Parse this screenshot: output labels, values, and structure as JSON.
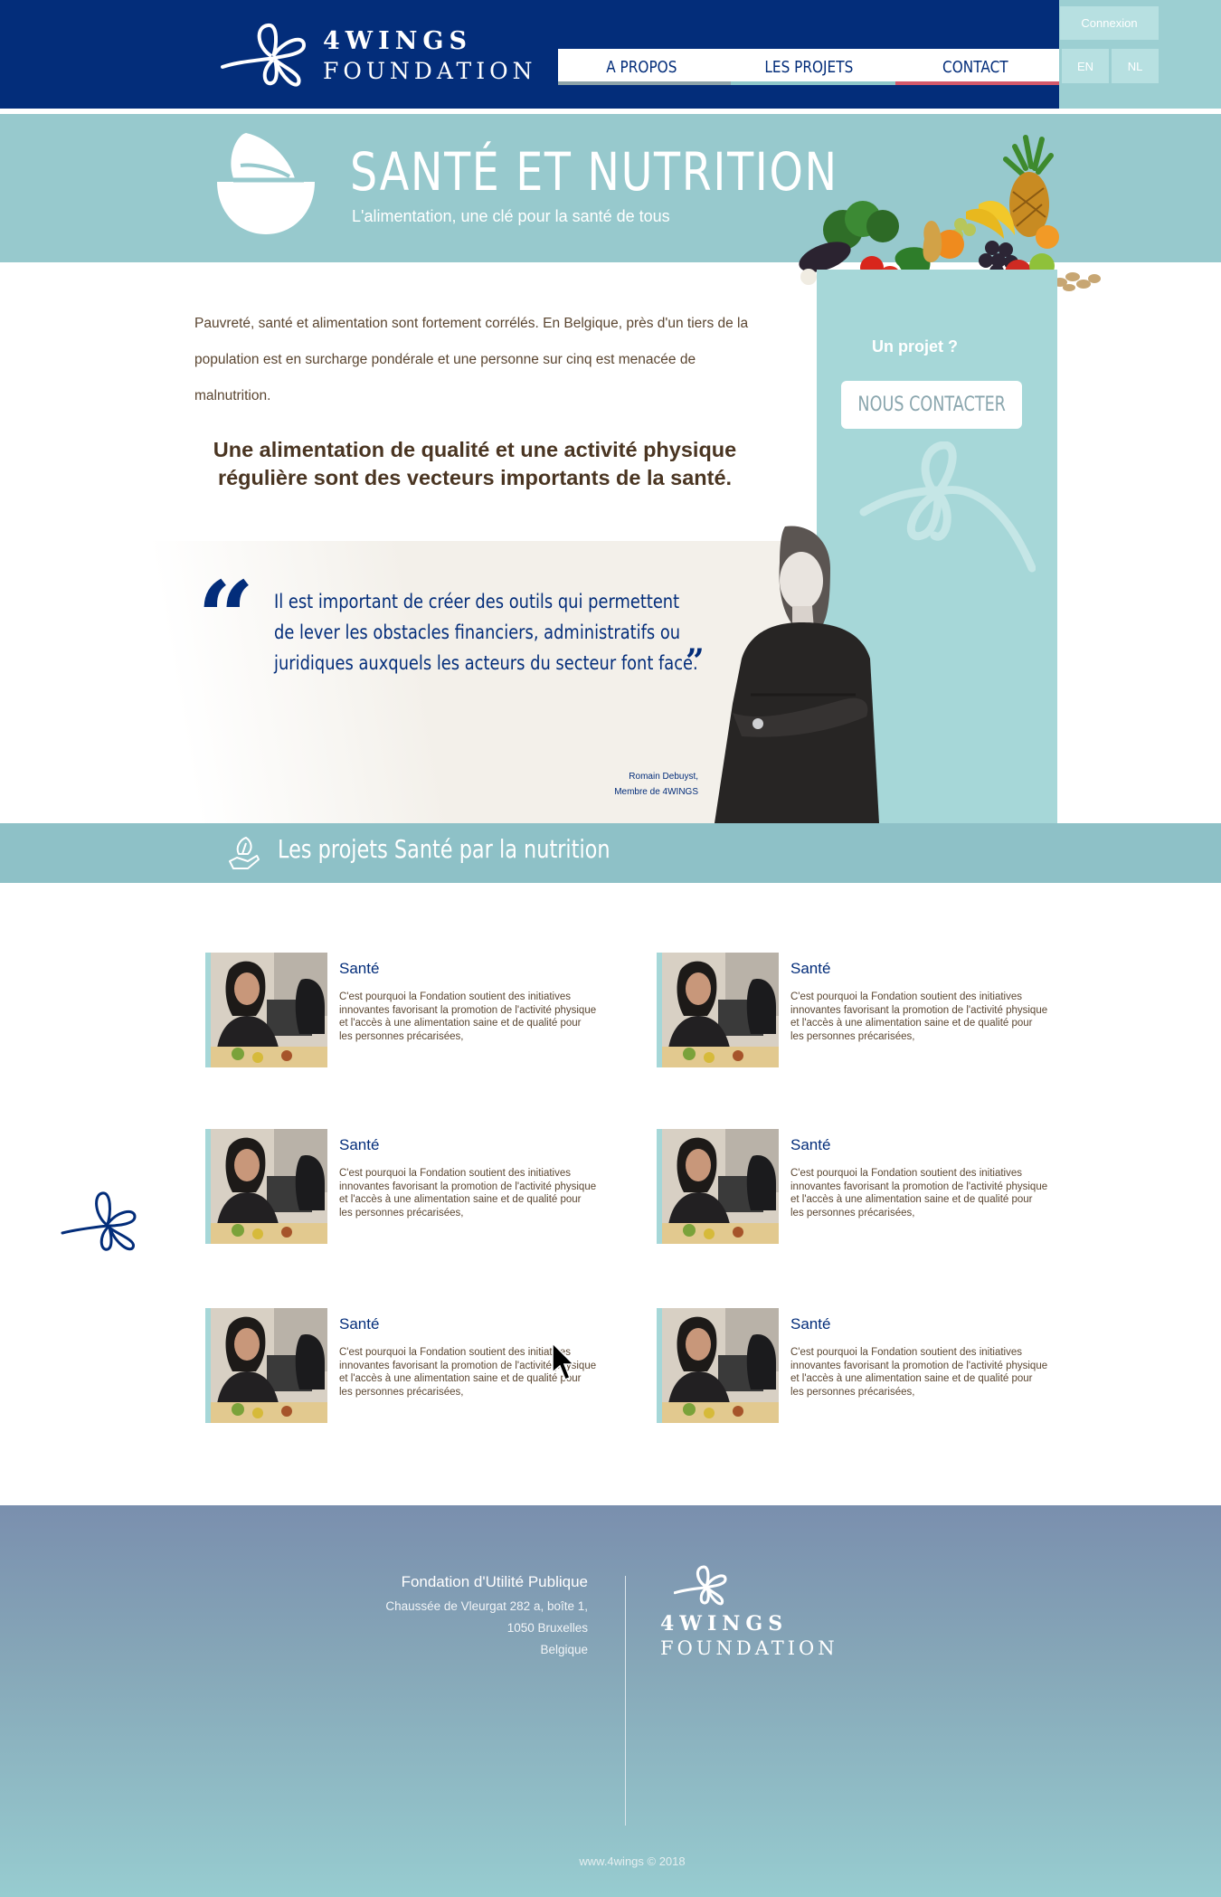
{
  "brand": {
    "name_line1": "4WINGS",
    "name_line2": "FOUNDATION"
  },
  "nav": {
    "items": [
      {
        "label": "A PROPOS"
      },
      {
        "label": "LES PROJETS"
      },
      {
        "label": "CONTACT"
      }
    ],
    "login_label": "Connexion",
    "languages": [
      "EN",
      "NL"
    ]
  },
  "hero": {
    "title": "SANTÉ ET NUTRITION",
    "subtitle": "L'alimentation, une clé pour la santé de tous",
    "icon": "bowl-leaf-icon"
  },
  "intro": {
    "paragraph": "Pauvreté, santé et alimentation sont fortement corrélés. En Belgique, près d'un tiers de la population est en surcharge pondérale et une personne sur cinq est menacée de malnutrition.",
    "highlight": "Une alimentation de qualité et une activité physique régulière sont des vecteurs importants de la santé."
  },
  "sidebar": {
    "question": "Un projet  ?",
    "contact_button": "NOUS CONTACTER"
  },
  "quote": {
    "text": "Il est important de créer des outils qui permettent de lever les obstacles financiers, administratifs ou juridiques auxquels les acteurs du secteur font face.",
    "author_name": "Romain Debuyst,",
    "author_role": "Membre de 4WINGS"
  },
  "projects": {
    "section_title": "Les projets Santé par la nutrition",
    "cards": [
      {
        "title": "Santé",
        "text": "C'est pourquoi la Fondation soutient des initiatives innovantes favorisant la promotion de l'activité physique et l'accès à une alimentation saine et de qualité pour les personnes précarisées,"
      },
      {
        "title": "Santé",
        "text": "C'est pourquoi la Fondation soutient des initiatives innovantes favorisant la promotion de l'activité physique et l'accès à une alimentation saine et de qualité pour les personnes précarisées,"
      },
      {
        "title": "Santé",
        "text": "C'est pourquoi la Fondation soutient des initiatives innovantes favorisant la promotion de l'activité physique et l'accès à une alimentation saine et de qualité pour les personnes précarisées,"
      },
      {
        "title": "Santé",
        "text": "C'est pourquoi la Fondation soutient des initiatives innovantes favorisant la promotion de l'activité physique et l'accès à une alimentation saine et de qualité pour les personnes précarisées,"
      },
      {
        "title": "Santé",
        "text": "C'est pourquoi la Fondation soutient des initiatives innovantes favorisant la promotion de l'activité physique et l'accès à une alimentation saine et de qualité pour les personnes précarisées,"
      },
      {
        "title": "Santé",
        "text": "C'est pourquoi la Fondation soutient des initiatives innovantes favorisant la promotion de l'activité physique et l'accès à une alimentation saine et de qualité pour les personnes précarisées,"
      }
    ]
  },
  "footer": {
    "org": "Fondation d'Utilité Publique",
    "address_line1": "Chaussée de Vleurgat 282 a, boîte 1,",
    "address_line2": "1050 Bruxelles",
    "address_line3": "Belgique",
    "copyright": "www.4wings © 2018"
  },
  "colors": {
    "navy": "#032d7a",
    "teal": "#97c9cd",
    "light_teal": "#a6d7d8",
    "brown_text": "#5b4631",
    "nav_accent_red": "#d3596b"
  }
}
